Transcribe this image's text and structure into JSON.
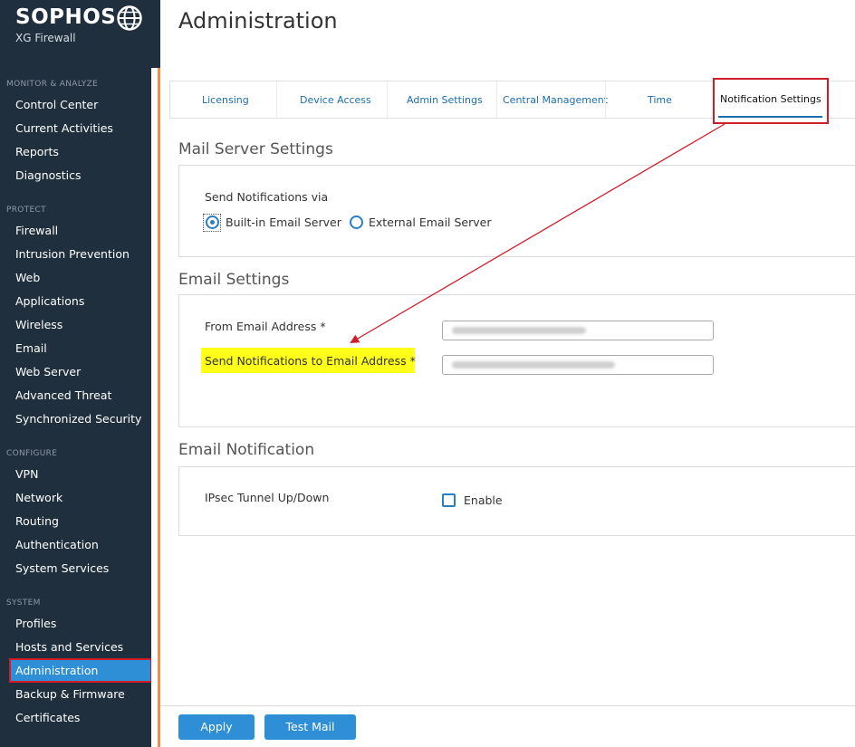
{
  "brand": {
    "name": "SOPHOS",
    "product": "XG Firewall"
  },
  "sidebar": {
    "sections": [
      {
        "title": "MONITOR & ANALYZE",
        "items": [
          "Control Center",
          "Current Activities",
          "Reports",
          "Diagnostics"
        ]
      },
      {
        "title": "PROTECT",
        "items": [
          "Firewall",
          "Intrusion Prevention",
          "Web",
          "Applications",
          "Wireless",
          "Email",
          "Web Server",
          "Advanced Threat",
          "Synchronized Security"
        ]
      },
      {
        "title": "CONFIGURE",
        "items": [
          "VPN",
          "Network",
          "Routing",
          "Authentication",
          "System Services"
        ]
      },
      {
        "title": "SYSTEM",
        "items": [
          "Profiles",
          "Hosts and Services",
          "Administration",
          "Backup & Firmware",
          "Certificates"
        ]
      }
    ],
    "active_item": "Administration"
  },
  "page": {
    "title": "Administration"
  },
  "tabs": [
    "Licensing",
    "Device Access",
    "Admin Settings",
    "Central Management",
    "Time",
    "Notification Settings"
  ],
  "active_tab": "Notification Settings",
  "mail_server": {
    "title": "Mail Server Settings",
    "send_via_label": "Send Notifications via",
    "option_builtin": "Built-in Email Server",
    "option_external": "External Email Server",
    "selected": "Built-in Email Server"
  },
  "email_settings": {
    "title": "Email Settings",
    "from_label": "From Email Address *",
    "to_label": "Send Notifications to Email Address *"
  },
  "email_notification": {
    "title": "Email Notification",
    "ipsec_label": "IPsec Tunnel Up/Down",
    "enable_label": "Enable",
    "enabled": false
  },
  "footer": {
    "apply_label": "Apply",
    "test_mail_label": "Test Mail"
  },
  "colors": {
    "sidebar_bg": "#1f2f3d",
    "accent": "#2f8fd6",
    "annotation_red": "#d11c2a",
    "highlight_yellow": "#ffff1a",
    "orange_strip": "#ef8f4e"
  }
}
